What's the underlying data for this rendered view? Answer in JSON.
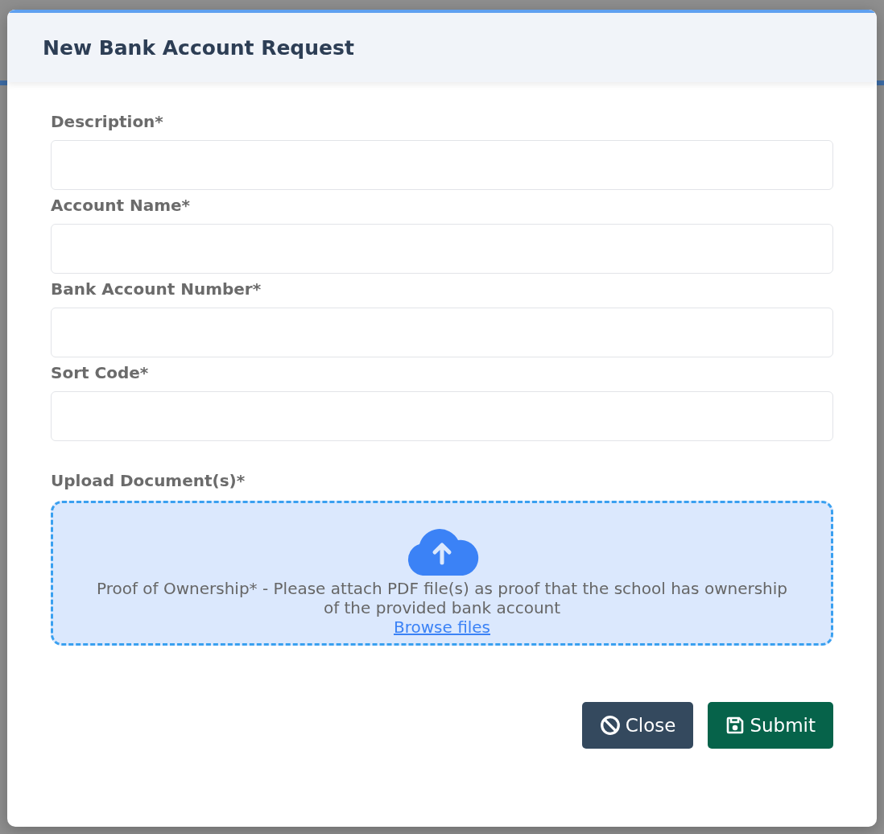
{
  "dialog": {
    "title": "New Bank Account Request"
  },
  "fields": [
    {
      "label": "Description*"
    },
    {
      "label": "Account Name*"
    },
    {
      "label": "Bank Account Number*"
    },
    {
      "label": "Sort Code*"
    }
  ],
  "upload": {
    "label": "Upload Document(s)*",
    "hint": "Proof of Ownership* - Please attach PDF file(s) as proof that the school has ownership of the provided bank account",
    "link": "Browse files"
  },
  "buttons": [
    {
      "kind": "close",
      "label": "Close"
    },
    {
      "kind": "submit",
      "label": "Submit"
    }
  ]
}
